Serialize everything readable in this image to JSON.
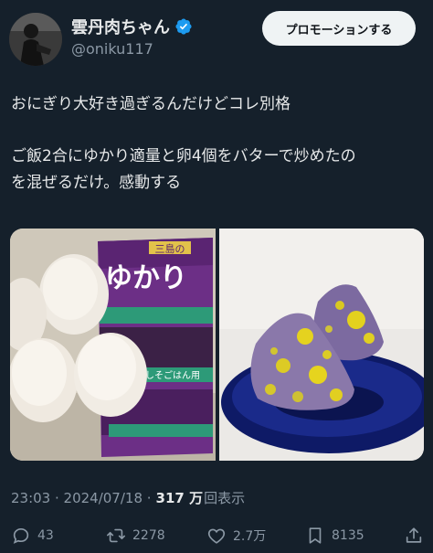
{
  "author": {
    "name": "雲丹肉ちゃん",
    "handle": "@oniku117"
  },
  "promo_button": "プロモーションする",
  "tweet": {
    "line1": "おにぎり大好き過ぎるんだけどコレ別格",
    "line2": "ご飯2合にゆかり適量と卵4個をバターで炒めたの",
    "line3": "を混ぜるだけ。感動する"
  },
  "media": {
    "package_brand": "三島の",
    "package_title": "ゆかり",
    "package_sub": "しそごはん用"
  },
  "meta": {
    "timestamp": "23:03 · 2024/07/18 · ",
    "views_count": "317 万",
    "views_label": "回表示"
  },
  "actions": {
    "replies": "43",
    "reposts": "2278",
    "likes": "2.7万",
    "bookmarks": "8135"
  },
  "colors": {
    "background": "#15202b",
    "verified": "#1d9bf0",
    "text": "#e7e9ea",
    "muted": "#8b98a5"
  }
}
